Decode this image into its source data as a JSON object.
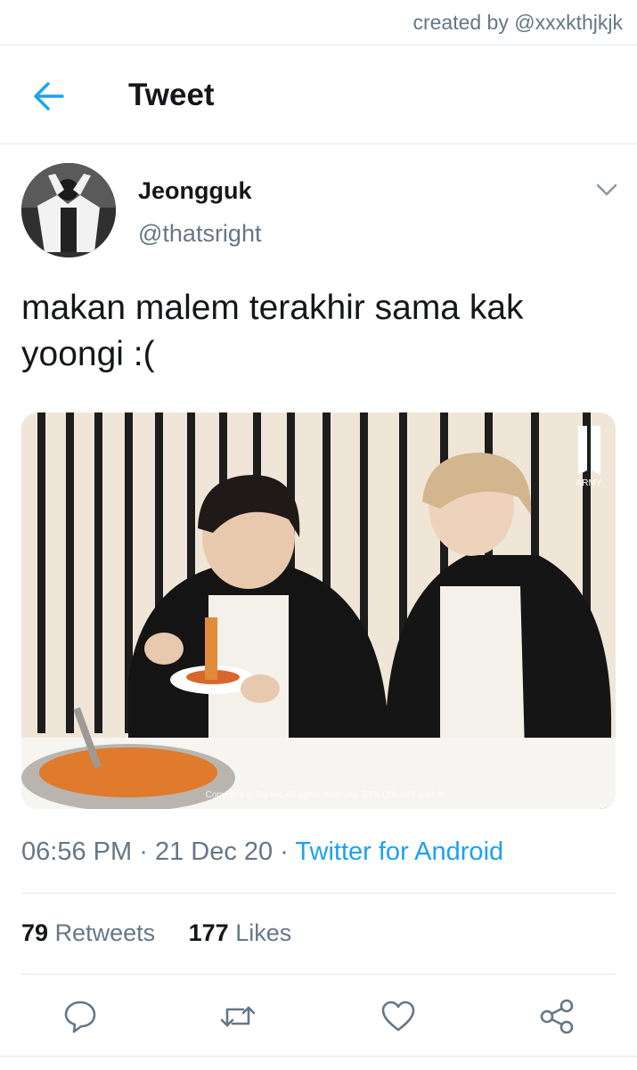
{
  "credit": "created by @xxxkthjkjk",
  "header": {
    "title": "Tweet",
    "back_icon": "arrow-left-icon"
  },
  "author": {
    "name": "Jeongguk",
    "handle": "@thatsright",
    "menu_icon": "chevron-down-icon"
  },
  "tweet": {
    "text": "makan malem terakhir sama kak yoongi :(",
    "media": {
      "watermark": "ARMY",
      "copyright": "Copyright © Big Hit. All rights reserved. BTS Official Fanclub"
    }
  },
  "meta": {
    "time": "06:56 PM",
    "sep1": "·",
    "date": "21 Dec 20",
    "sep2": "·",
    "source": "Twitter for Android"
  },
  "stats": {
    "retweets_count": "79",
    "retweets_label": "Retweets",
    "likes_count": "177",
    "likes_label": "Likes"
  },
  "actions": [
    "reply-icon",
    "retweet-icon",
    "like-icon",
    "share-icon"
  ],
  "colors": {
    "accent": "#1da1f2",
    "secondary_text": "#657786",
    "divider": "#e1e8ed"
  }
}
